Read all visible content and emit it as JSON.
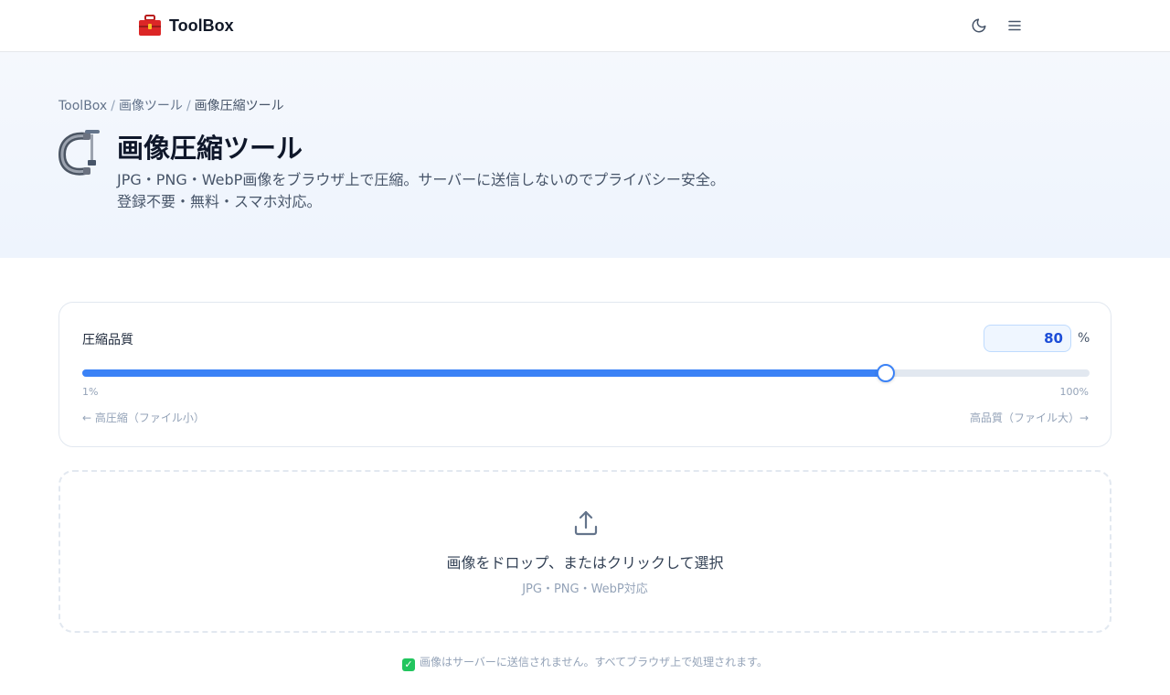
{
  "header": {
    "logo_text": "ToolBox",
    "logo_icon": "toolbox-icon",
    "theme_icon": "moon-icon",
    "menu_icon": "hamburger-menu-icon"
  },
  "breadcrumb": {
    "items": [
      {
        "label": "ToolBox"
      },
      {
        "label": "画像ツール"
      },
      {
        "label": "画像圧縮ツール"
      }
    ],
    "separator": "/"
  },
  "hero": {
    "icon": "clamp-icon",
    "title": "画像圧縮ツール",
    "description_line1": "JPG・PNG・WebP画像をブラウザ上で圧縮。サーバーに送信しないのでプライバシー安全。",
    "description_line2": "登録不要・無料・スマホ対応。"
  },
  "quality": {
    "label": "圧縮品質",
    "value": "80",
    "unit": "%",
    "slider_min": 1,
    "slider_max": 100,
    "slider_value": 80,
    "min_label": "1%",
    "max_label": "100%",
    "hint_low": "← 高圧縮（ファイル小）",
    "hint_high": "高品質（ファイル大）→"
  },
  "dropzone": {
    "icon": "upload-icon",
    "text": "画像をドロップ、またはクリックして選択",
    "sub": "JPG・PNG・WebP対応"
  },
  "note": {
    "icon": "check-mark-icon",
    "text": "画像はサーバーに送信されません。すべてブラウザ上で処理されます。"
  },
  "colors": {
    "accent": "#3b82f6",
    "accent_dark": "#1d4ed8",
    "track": "#e2e8f0",
    "check": "#22c55e"
  }
}
